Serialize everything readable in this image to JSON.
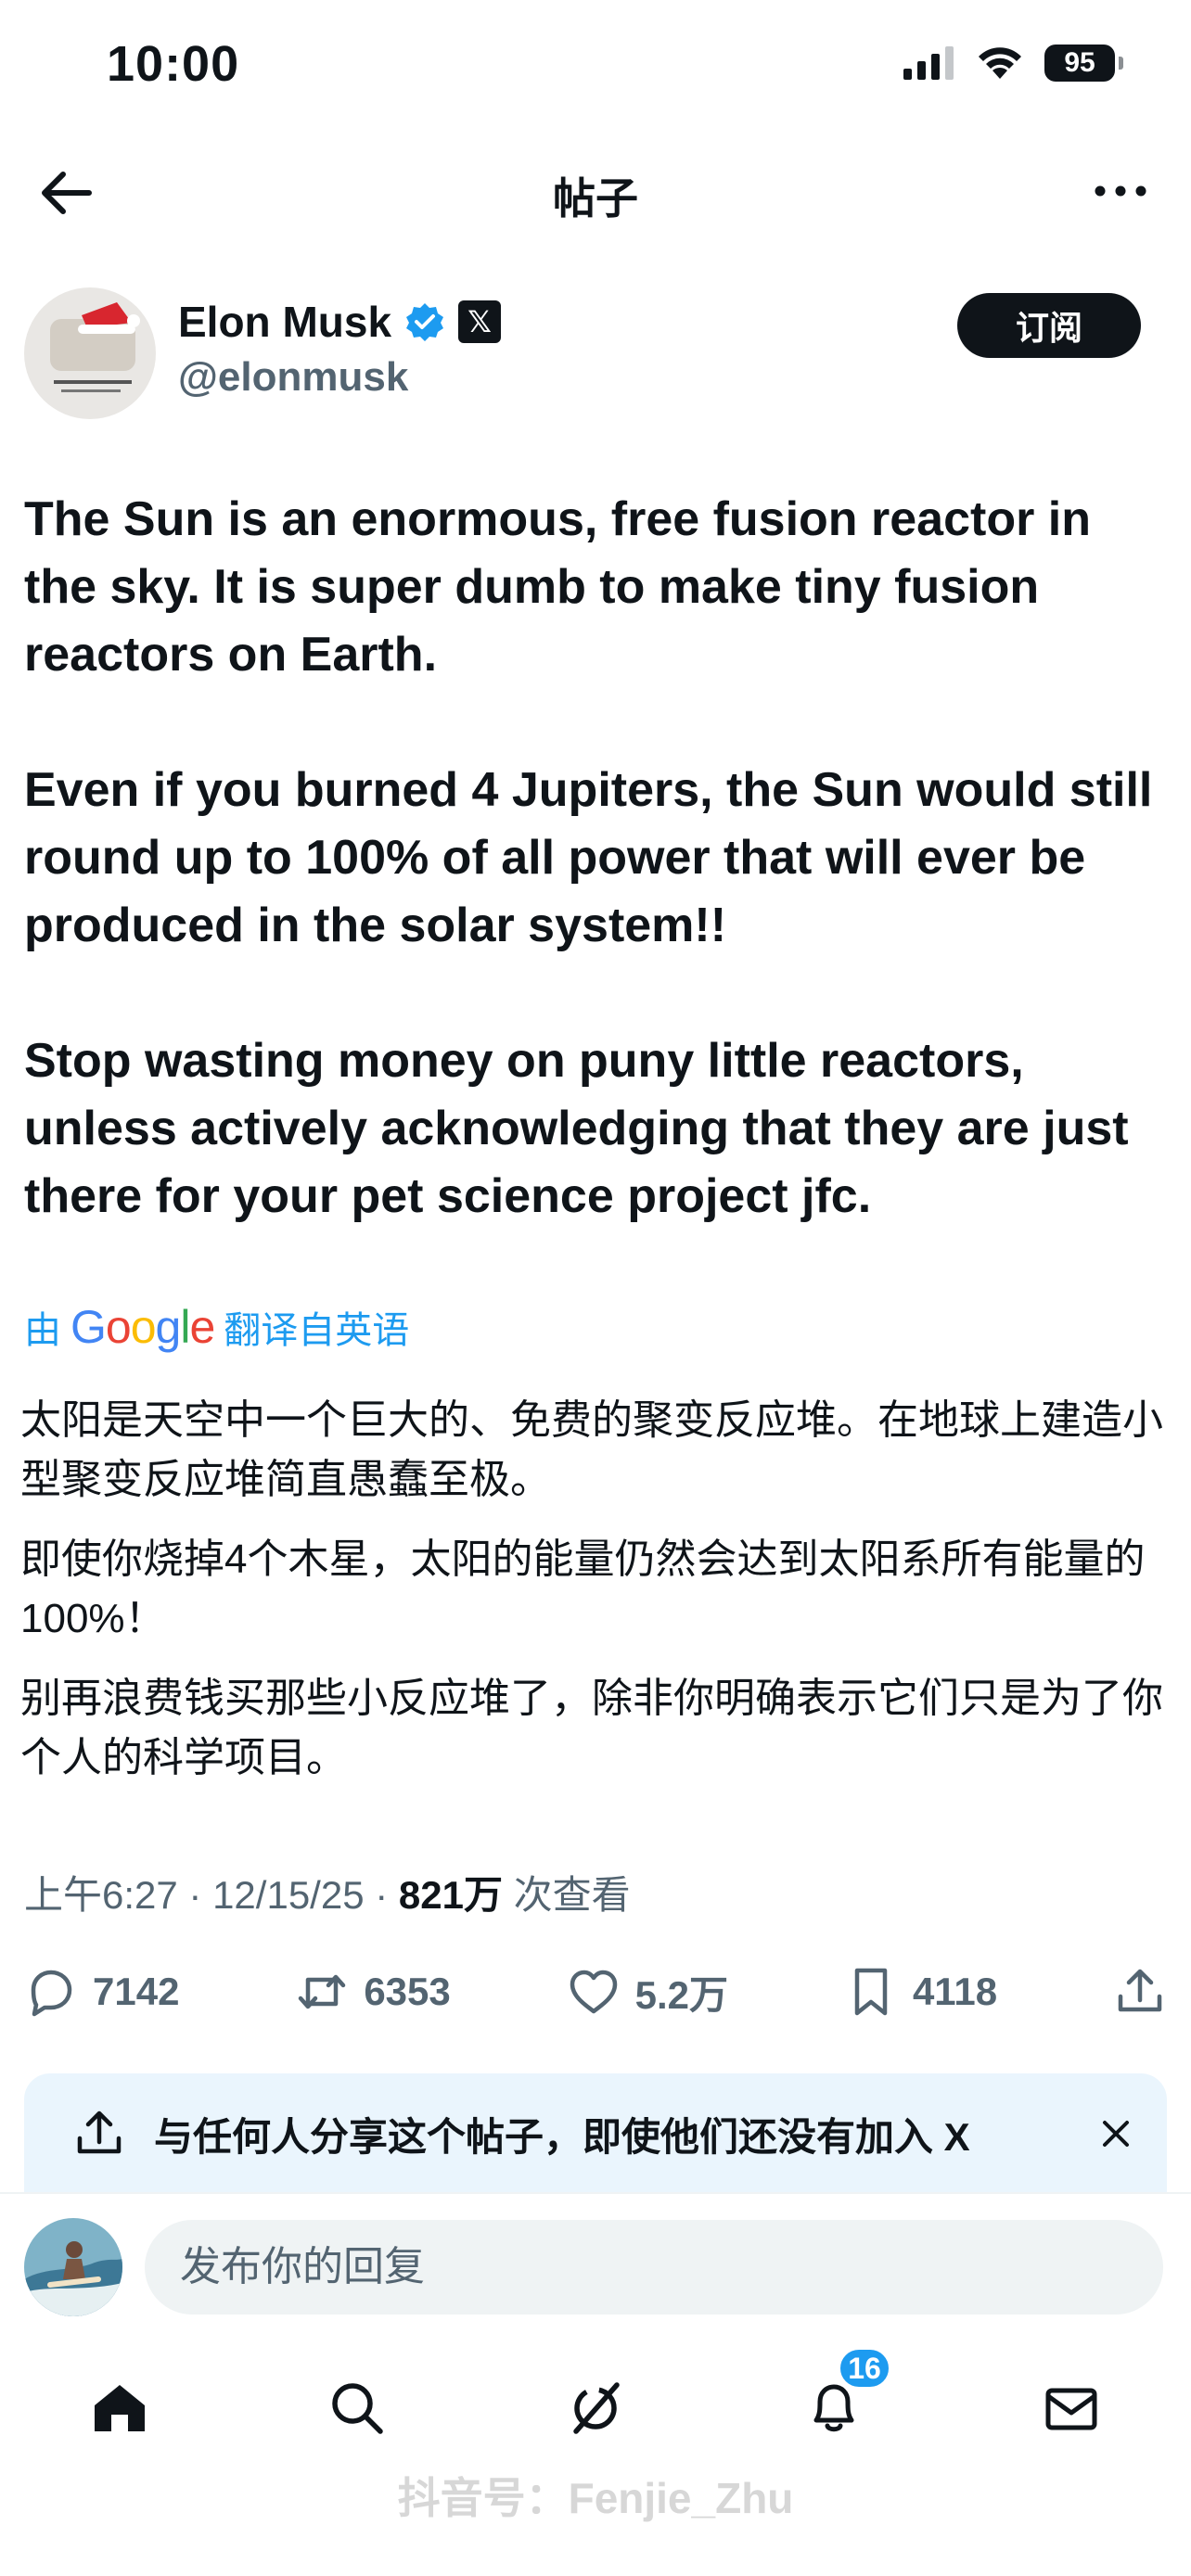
{
  "status_bar": {
    "time": "10:00",
    "battery": "95"
  },
  "header": {
    "title": "帖子"
  },
  "author": {
    "name": "Elon Musk",
    "handle": "@elonmusk",
    "x_badge": "𝕏",
    "subscribe_label": "订阅"
  },
  "post": {
    "paragraphs": [
      "The Sun is an enormous, free fusion reactor in the sky. It is super dumb to make tiny fusion reactors on Earth.",
      "Even if you burned 4 Jupiters, the Sun would still round up to 100% of all power that will ever be produced in the solar system!!",
      "Stop wasting money on puny little reactors, unless actively acknowledging that they are just there for your pet science project jfc."
    ]
  },
  "translation": {
    "prefix": "由",
    "brand": "Google",
    "suffix": "翻译自英语",
    "paragraphs": [
      "太阳是天空中一个巨大的、免费的聚变反应堆。在地球上建造小型聚变反应堆简直愚蠢至极。",
      "即使你烧掉4个木星，太阳的能量仍然会达到太阳系所有能量的100%！",
      "别再浪费钱买那些小反应堆了，除非你明确表示它们只是为了你个人的科学项目。"
    ]
  },
  "meta": {
    "time": "上午6:27",
    "date": "12/15/25",
    "views": "821万",
    "views_label": "次查看"
  },
  "actions": {
    "replies": "7142",
    "reposts": "6353",
    "likes": "5.2万",
    "bookmarks": "4118"
  },
  "share_banner": {
    "text": "与任何人分享这个帖子，即使他们还没有加入 X"
  },
  "reply": {
    "placeholder": "发布你的回复"
  },
  "nav": {
    "notification_count": "16"
  },
  "watermark": "抖音号：Fenjie_Zhu",
  "colors": {
    "accent": "#1d9bf0",
    "text": "#0f1419",
    "secondary": "#536471",
    "banner_bg": "#eaf5fd"
  }
}
